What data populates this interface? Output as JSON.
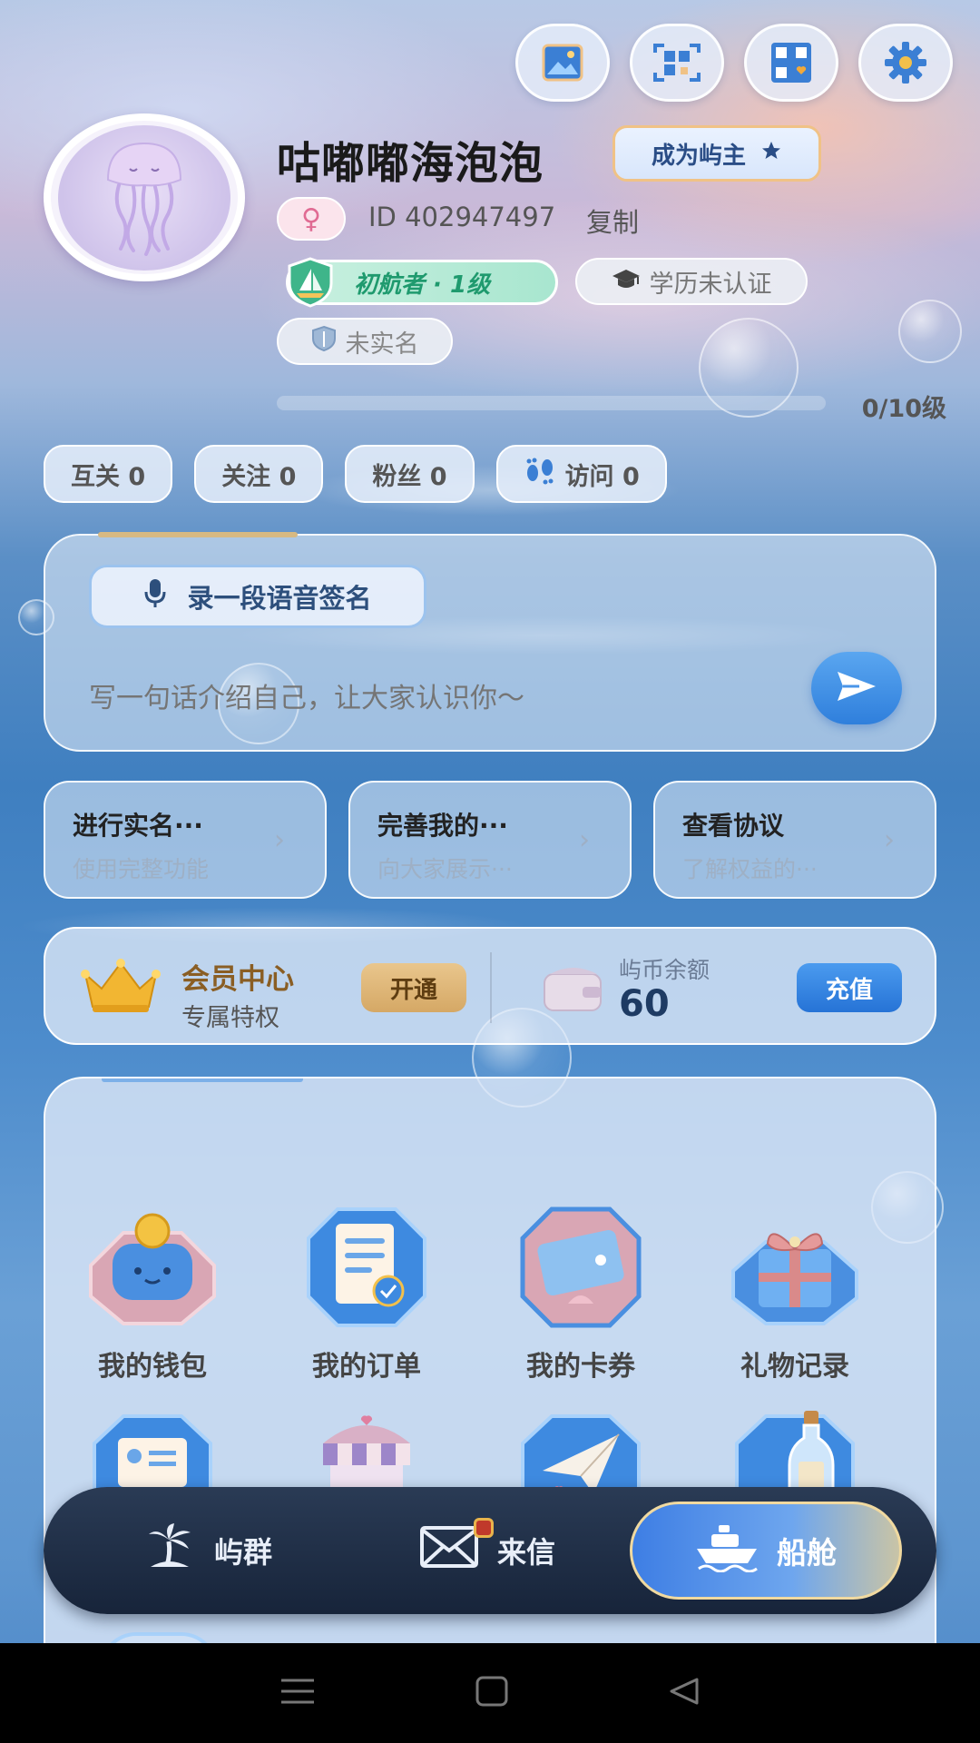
{
  "header": {
    "top_icons": [
      "gallery-icon",
      "scan-icon",
      "qrcode-icon",
      "settings-icon"
    ]
  },
  "profile": {
    "nickname": "咕嘟嘟海泡泡",
    "owner_button": "成为屿主",
    "gender_symbol": "♀",
    "id_text": "ID 402947497",
    "copy_label": "复制",
    "level_badge": "初航者 · 1级",
    "education_badge": "学历未认证",
    "realname_badge": "未实名",
    "level_progress_text": "0/10级",
    "level_progress_fraction": 0
  },
  "stats": [
    {
      "label": "互关 0",
      "icon": ""
    },
    {
      "label": "关注 0",
      "icon": ""
    },
    {
      "label": "粉丝 0",
      "icon": ""
    },
    {
      "label": "访问 0",
      "icon": "footprints-icon"
    }
  ],
  "signature": {
    "voice_button": "录一段语音签名",
    "placeholder": "写一句话介绍自己，让大家认识你～"
  },
  "tasks": [
    {
      "title": "进行实名···",
      "subtitle": "使用完整功能"
    },
    {
      "title": "完善我的···",
      "subtitle": "向大家展示···"
    },
    {
      "title": "查看协议",
      "subtitle": "了解权益的···"
    }
  ],
  "member": {
    "title": "会员中心",
    "subtitle": "专属特权",
    "open_button": "开通",
    "coin_label": "屿币余额",
    "coin_value": "60",
    "recharge_button": "充值"
  },
  "tools": [
    {
      "label": "我的钱包",
      "icon": "wallet-icon"
    },
    {
      "label": "我的订单",
      "icon": "order-icon"
    },
    {
      "label": "我的卡券",
      "icon": "coupon-icon"
    },
    {
      "label": "礼物记录",
      "icon": "gift-icon"
    }
  ],
  "tools_row2_icons": [
    "id-card-icon",
    "shop-icon",
    "paper-plane-icon",
    "bottle-icon"
  ],
  "bottom_nav": {
    "items": [
      {
        "label": "屿群",
        "icon": "island-icon"
      },
      {
        "label": "来信",
        "icon": "mail-icon"
      },
      {
        "label": "船舱",
        "icon": "ship-icon"
      }
    ],
    "active_index": 2
  },
  "colors": {
    "accent_blue": "#2f7fdc",
    "gold": "#d5a865",
    "nav_dark": "#17243a",
    "level_green": "#1f9a6e"
  }
}
